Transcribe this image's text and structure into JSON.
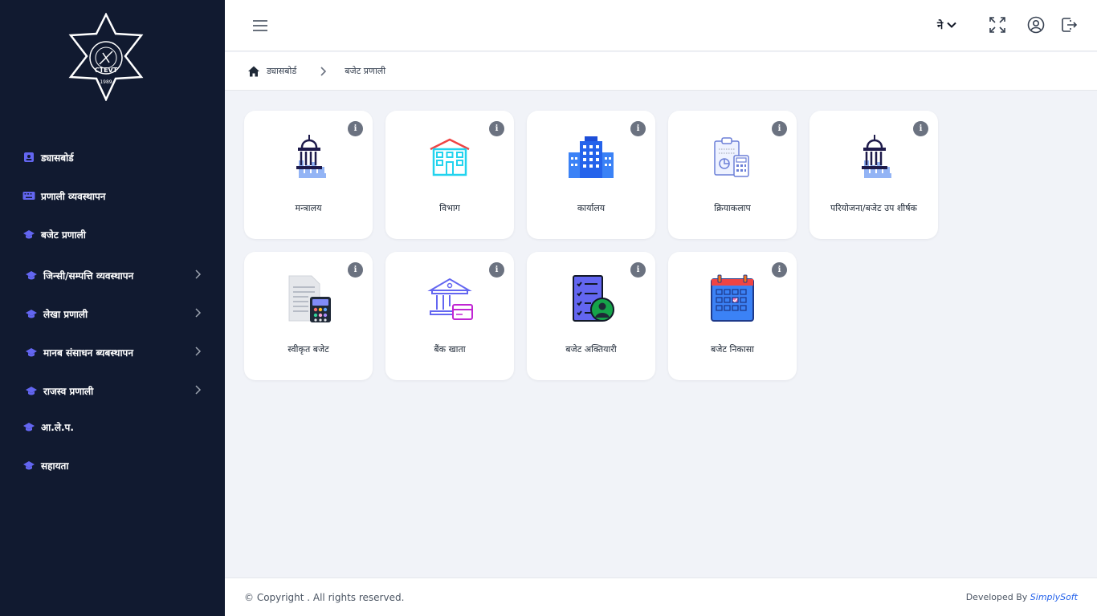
{
  "sidebar": {
    "logo_text": "CTEVT",
    "logo_year": "1989",
    "items": [
      {
        "label": "ड्यासबोर्ड",
        "icon": "id-badge-icon"
      },
      {
        "label": "प्रणाली व्यवस्थापन",
        "icon": "keyboard-icon"
      },
      {
        "label": "बजेट प्रणाली",
        "icon": "graduation-cap-icon"
      },
      {
        "label": "जिन्सी/सम्पत्ति व्यवस्थापन",
        "icon": "graduation-cap-icon",
        "expandable": true
      },
      {
        "label": "लेखा प्रणाली",
        "icon": "graduation-cap-icon",
        "expandable": true
      },
      {
        "label": "मानब संसाधन ब्यबस्थापन",
        "icon": "graduation-cap-icon",
        "expandable": true
      },
      {
        "label": "राजस्व प्रणाली",
        "icon": "graduation-cap-icon",
        "expandable": true
      },
      {
        "label": "आ.ले.प.",
        "icon": "graduation-cap-icon"
      },
      {
        "label": "सहायता",
        "icon": "graduation-cap-icon"
      }
    ]
  },
  "header": {
    "lang_label": "ने",
    "icons": [
      "menu-icon",
      "chevron-down-icon",
      "fullscreen-icon",
      "user-circle-icon",
      "logout-icon"
    ]
  },
  "breadcrumb": {
    "home_label": "ड्यासबोर्ड",
    "current_label": "बजेट प्रणाली"
  },
  "cards": [
    {
      "label": "मन्त्रालय",
      "icon": "ministry-building-icon"
    },
    {
      "label": "विभाग",
      "icon": "department-building-icon"
    },
    {
      "label": "कार्यालय",
      "icon": "office-buildings-icon"
    },
    {
      "label": "क्रियाकलाप",
      "icon": "activity-clipboard-icon"
    },
    {
      "label": "परियोजना/बजेट उप शीर्षक",
      "icon": "project-building-icon"
    },
    {
      "label": "स्वीकृत बजेट",
      "icon": "approved-budget-calculator-icon"
    },
    {
      "label": "बैंक खाता",
      "icon": "bank-account-icon"
    },
    {
      "label": "बजेट अक्तियारी",
      "icon": "budget-authority-icon"
    },
    {
      "label": "बजेट निकासा",
      "icon": "budget-release-calendar-icon"
    }
  ],
  "info_glyph": "i",
  "footer": {
    "copyright": "© Copyright . All rights reserved.",
    "developed_by": "Developed By",
    "developer": "SimplySoft"
  },
  "colors": {
    "sidebar_bg": "#111a30",
    "nav_icon": "#6366f1",
    "page_bg": "#f1f3f8",
    "link": "#2563eb"
  }
}
